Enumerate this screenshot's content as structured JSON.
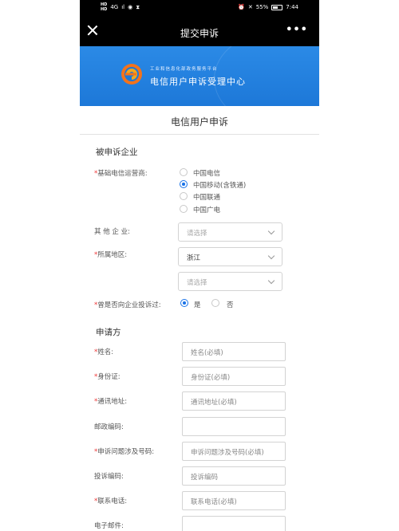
{
  "statusbar": {
    "hd_top": "HD",
    "hd_bottom": "HD",
    "network": "4G",
    "signal": "ıl",
    "battery_percent": "55%",
    "time": "7:44"
  },
  "titlebar": {
    "title": "提交申诉",
    "more": "•••"
  },
  "banner": {
    "subtitle": "工业和信息化部政务服务平台",
    "title": "电信用户申诉受理中心"
  },
  "page_title": "电信用户申诉",
  "complained_company": {
    "section_title": "被申诉企业",
    "operator_label": "基础电信运营商:",
    "operator_options": [
      "中国电信",
      "中国移动(含铁通)",
      "中国联通",
      "中国广电"
    ],
    "operator_selected": 1,
    "other_company_label": "其 他 企 业:",
    "other_company_placeholder": "请选择",
    "region_label": "所属地区:",
    "region_value": "浙江",
    "region_sub_placeholder": "请选择",
    "complained_before_label": "曾是否向企业投诉过:",
    "yes": "是",
    "no": "否"
  },
  "applicant": {
    "section_title": "申请方",
    "fields": [
      {
        "label": "姓名:",
        "required": true,
        "placeholder": "姓名(必填)"
      },
      {
        "label": "身份证:",
        "required": true,
        "placeholder": "身份证(必填)"
      },
      {
        "label": "通讯地址:",
        "required": true,
        "placeholder": "通讯地址(必填)"
      },
      {
        "label": "邮政编码:",
        "required": false,
        "placeholder": ""
      },
      {
        "label": "申诉问题涉及号码:",
        "required": true,
        "placeholder": "申诉问题涉及号码(必填)"
      },
      {
        "label": "投诉编码:",
        "required": false,
        "placeholder": "投诉编码"
      },
      {
        "label": "联系电话:",
        "required": true,
        "placeholder": "联系电话(必填)"
      },
      {
        "label": "电子邮件:",
        "required": false,
        "placeholder": ""
      }
    ]
  },
  "colors": {
    "accent": "#1a73e8",
    "banner": "#2b8ae6",
    "required": "#e33333"
  }
}
